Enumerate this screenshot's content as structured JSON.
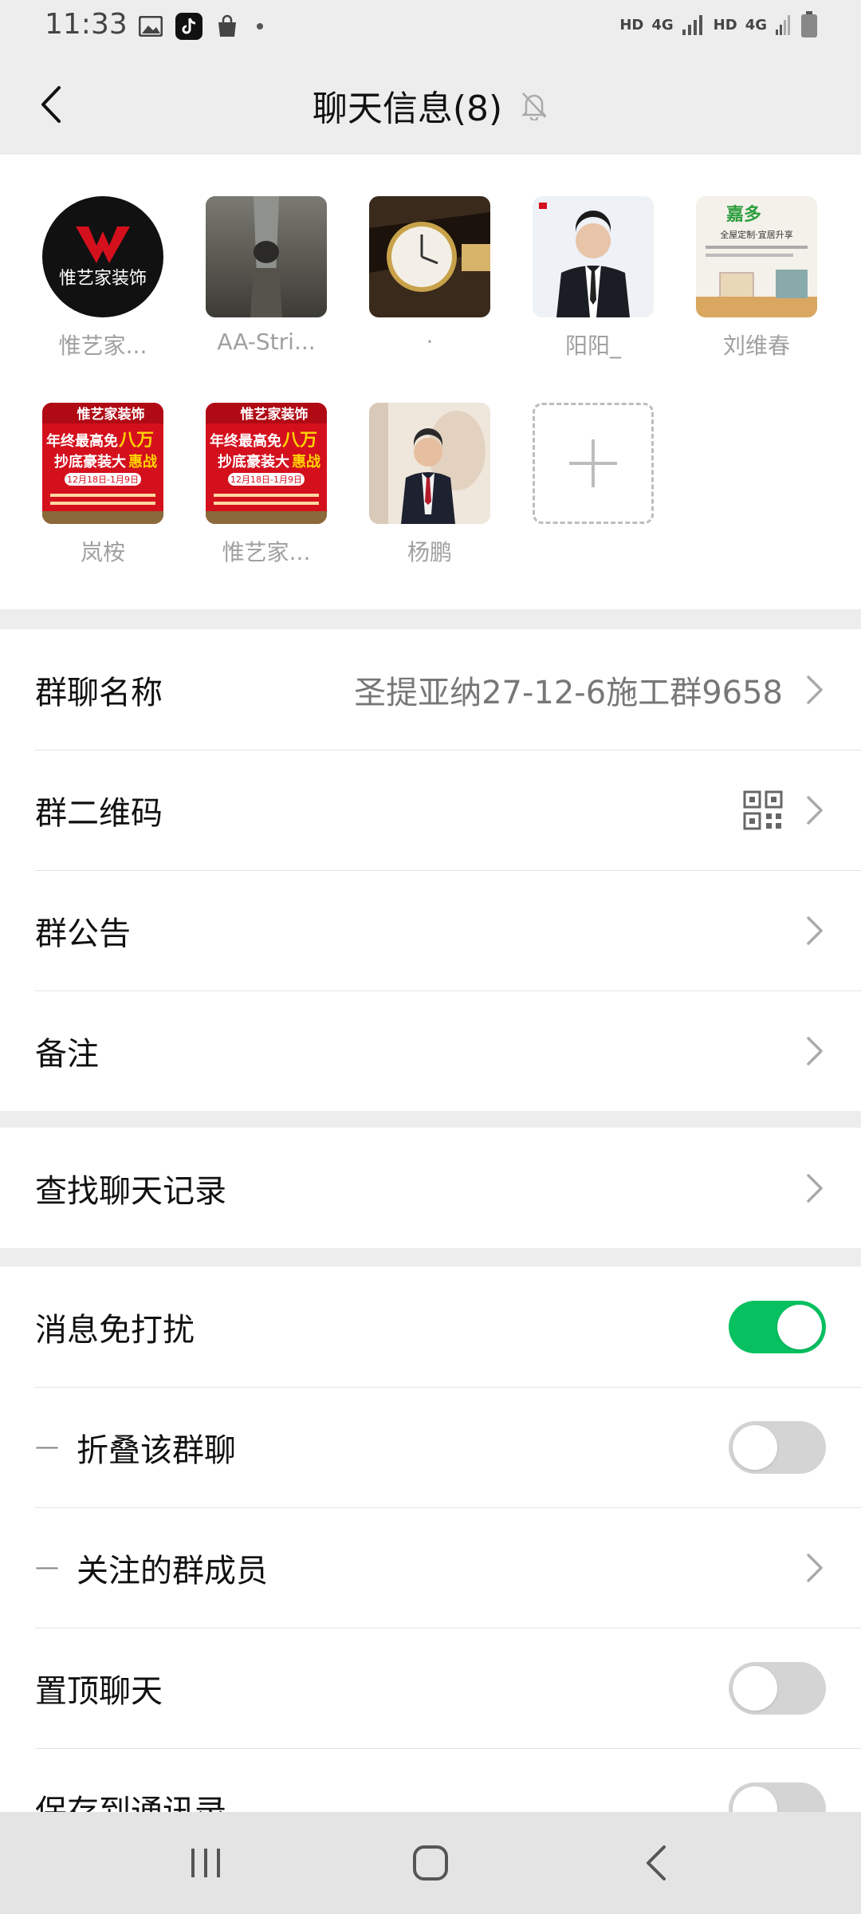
{
  "status_bar": {
    "time": "11:33",
    "hd1": "HD",
    "net1": "4G",
    "hd2": "HD",
    "net2": "4G"
  },
  "header": {
    "title": "聊天信息(8)",
    "back_icon": "chevron-left-icon",
    "mute_icon": "bell-off-icon"
  },
  "members": [
    {
      "name": "惟艺家...",
      "avatar": "logo-black-circle"
    },
    {
      "name": "AA-Stri...",
      "avatar": "rock-photo"
    },
    {
      "name": "·",
      "avatar": "watch-photo"
    },
    {
      "name": "阳阳_",
      "avatar": "man-in-suit"
    },
    {
      "name": "刘维春",
      "avatar": "interior-ad"
    },
    {
      "name": "岚桉",
      "avatar": "red-promo-poster"
    },
    {
      "name": "惟艺家...",
      "avatar": "red-promo-poster"
    },
    {
      "name": "杨鹏",
      "avatar": "man-portrait"
    }
  ],
  "avatar_text": {
    "logo": "惟艺家装饰",
    "poster_brand": "惟艺家装饰",
    "poster_line1": "年终最高免",
    "poster_highlight": "八万",
    "poster_line2": "抄底豪装大",
    "poster_highlight2": "惠战",
    "poster_date": "12月18日-1月9日",
    "ad_brand": "嘉多",
    "ad_tagline": "全屋定制·宜居升享"
  },
  "settings": {
    "group_name_label": "群聊名称",
    "group_name_value": "圣提亚纳27-12-6施工群9658",
    "qr_label": "群二维码",
    "notice_label": "群公告",
    "remark_label": "备注",
    "search_label": "查找聊天记录",
    "mute_label": "消息免打扰",
    "mute_on": true,
    "fold_label": "折叠该群聊",
    "fold_on": false,
    "followed_label": "关注的群成员",
    "pin_label": "置顶聊天",
    "pin_on": false,
    "save_label": "保存到通讯录",
    "save_on": false
  },
  "colors": {
    "accent": "#07c160",
    "background": "#ededed",
    "poster_red": "#d4101d"
  }
}
